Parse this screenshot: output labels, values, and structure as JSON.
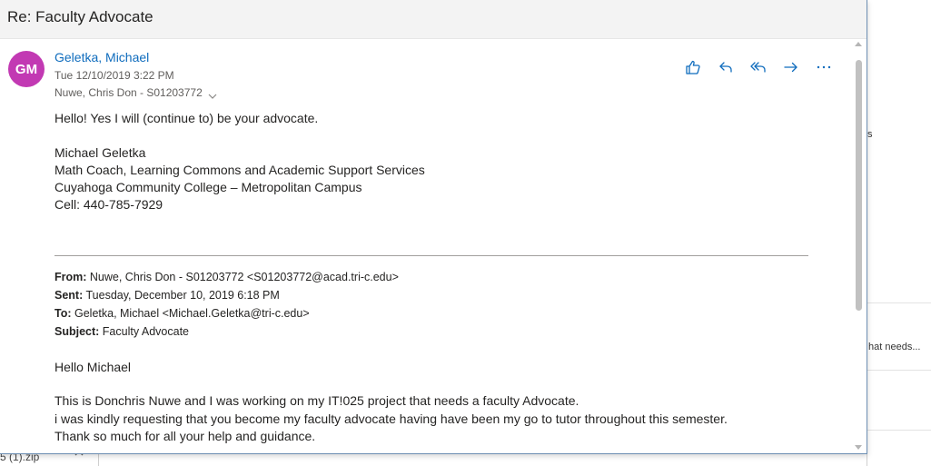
{
  "popup": {
    "title": "Re: Faculty Advocate"
  },
  "message": {
    "avatar_initials": "GM",
    "sender": "Geletka, Michael",
    "date": "Tue 12/10/2019 3:22 PM",
    "recipient": "Nuwe, Chris Don - S01203772",
    "actions": [
      "like-icon",
      "reply-icon",
      "reply-all-icon",
      "forward-icon",
      "more-icon"
    ],
    "body": [
      "Hello!  Yes I will (continue to) be your advocate.",
      "Michael Geletka",
      "Math Coach, Learning Commons and Academic Support Services",
      "Cuyahoga Community College – Metropolitan Campus",
      "Cell: 440-785-7929"
    ],
    "quoted": {
      "from_label": "From:",
      "from_value": "Nuwe, Chris Don - S01203772 <S01203772@acad.tri-c.edu>",
      "sent_label": "Sent:",
      "sent_value": "Tuesday, December 10, 2019 6:18 PM",
      "to_label": "To:",
      "to_value": "Geletka, Michael <Michael.Geletka@tri-c.edu>",
      "subject_label": "Subject:",
      "subject_value": "Faculty Advocate",
      "greeting": "Hello Michael",
      "lines": [
        "This is Donchris Nuwe and I was working on my IT!025 project that needs a faculty Advocate.",
        "i was kindly requesting that you become my faculty advocate having have been my go to tutor throughout this semester.",
        "Thank so much for all your help and guidance."
      ]
    }
  },
  "background": {
    "fragment_s": "s",
    "fragment_needs": "hat needs...",
    "attachment": "5 (1).zip"
  },
  "colors": {
    "accent": "#0f6cbd",
    "avatar": "#c239b3"
  }
}
